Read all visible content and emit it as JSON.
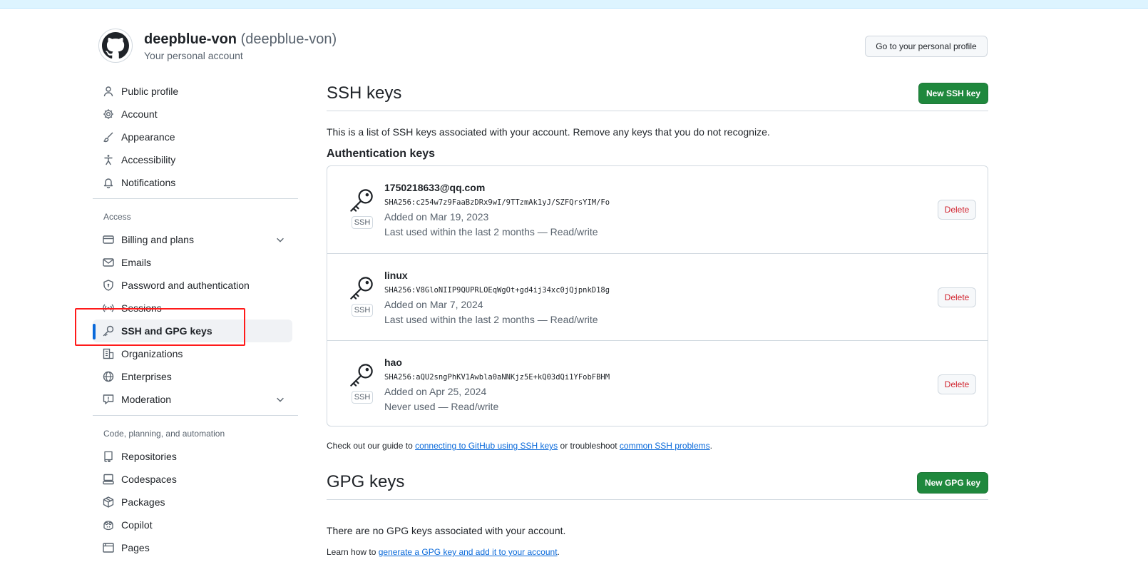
{
  "header": {
    "username": "deepblue-von",
    "handle": "(deepblue-von)",
    "subtitle": "Your personal account",
    "profile_button": "Go to your personal profile"
  },
  "sidebar": {
    "items_top": [
      {
        "label": "Public profile",
        "icon": "person-icon"
      },
      {
        "label": "Account",
        "icon": "gear-icon"
      },
      {
        "label": "Appearance",
        "icon": "paintbrush-icon"
      },
      {
        "label": "Accessibility",
        "icon": "accessibility-icon"
      },
      {
        "label": "Notifications",
        "icon": "bell-icon"
      }
    ],
    "access_header": "Access",
    "items_access": [
      {
        "label": "Billing and plans",
        "icon": "credit-card-icon"
      },
      {
        "label": "Emails",
        "icon": "mail-icon"
      },
      {
        "label": "Password and authentication",
        "icon": "shield-lock-icon"
      },
      {
        "label": "Sessions",
        "icon": "broadcast-icon"
      },
      {
        "label": "SSH and GPG keys",
        "icon": "key-icon"
      },
      {
        "label": "Organizations",
        "icon": "organization-icon"
      },
      {
        "label": "Enterprises",
        "icon": "globe-icon"
      },
      {
        "label": "Moderation",
        "icon": "report-icon"
      }
    ],
    "code_header": "Code, planning, and automation",
    "items_code": [
      {
        "label": "Repositories",
        "icon": "repo-icon"
      },
      {
        "label": "Codespaces",
        "icon": "codespaces-icon"
      },
      {
        "label": "Packages",
        "icon": "package-icon"
      },
      {
        "label": "Copilot",
        "icon": "copilot-icon"
      },
      {
        "label": "Pages",
        "icon": "browser-icon"
      }
    ]
  },
  "ssh": {
    "title": "SSH keys",
    "new_button": "New SSH key",
    "description": "This is a list of SSH keys associated with your account. Remove any keys that you do not recognize.",
    "auth_title": "Authentication keys",
    "badge": "SSH",
    "delete_label": "Delete",
    "keys": [
      {
        "title": "1750218633@qq.com",
        "fingerprint": "SHA256:c254w7z9FaaBzDRx9wI/9TTzmAk1yJ/SZFQrsYIM/Fo",
        "added": "Added on Mar 19, 2023",
        "usage": "Last used within the last 2 months — Read/write"
      },
      {
        "title": "linux",
        "fingerprint": "SHA256:V8GloNIIP9QUPRLOEqWgOt+gd4ij34xc0jQjpnkD18g",
        "added": "Added on Mar 7, 2024",
        "usage": "Last used within the last 2 months — Read/write"
      },
      {
        "title": "hao",
        "fingerprint": "SHA256:aQU2sngPhKV1Awbla0aNNKjz5E+kQ03dQi1YFobFBHM",
        "added": "Added on Apr 25, 2024",
        "usage": "Never used — Read/write"
      }
    ],
    "footer_prefix": "Check out our guide to ",
    "footer_link1": "connecting to GitHub using SSH keys",
    "footer_mid": " or troubleshoot ",
    "footer_link2": "common SSH problems",
    "footer_suffix": "."
  },
  "gpg": {
    "title": "GPG keys",
    "new_button": "New GPG key",
    "empty": "There are no GPG keys associated with your account.",
    "learn_prefix": "Learn how to ",
    "learn_link": "generate a GPG key and add it to your account",
    "learn_suffix": "."
  },
  "colors": {
    "accent": "#0969da",
    "green_button": "#1f883d",
    "danger": "#d1242f",
    "highlight": "#ff1a1a"
  }
}
